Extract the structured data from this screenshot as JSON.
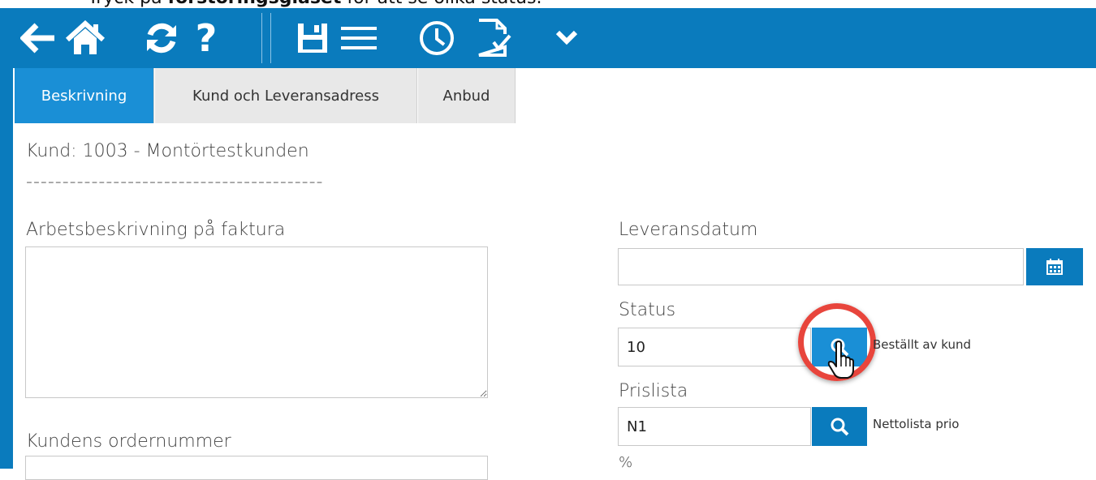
{
  "instruction": {
    "prefix": "Tryck på ",
    "bold": "förstoringsglaset",
    "suffix": " för att se olika status."
  },
  "toolbar": {
    "icons": [
      "back-arrow-icon",
      "home-icon",
      "refresh-icon",
      "help-icon",
      "save-icon",
      "menu-icon",
      "clock-icon",
      "document-check-icon",
      "chevron-down-icon"
    ]
  },
  "tabs": [
    "Beskrivning",
    "Kund och Leveransadress",
    "Anbud"
  ],
  "customer": {
    "line": "Kund: 1003 - Montörtestkunden",
    "divider": "-----------------------------------------"
  },
  "form": {
    "work_description_label": "Arbetsbeskrivning på faktura",
    "customer_order_label": "Kundens ordernummer",
    "delivery_date_label": "Leveransdatum",
    "delivery_date_value": "",
    "status_label": "Status",
    "status_value": "10",
    "status_text": "Beställt av kund",
    "pricelist_label": "Prislista",
    "pricelist_value": "N1",
    "pricelist_text": "Nettolista prio",
    "percent_label": "%"
  },
  "colors": {
    "toolbar": "#0a7bbd",
    "active_tab": "#1a8fd6",
    "highlight": "#e8453c"
  }
}
